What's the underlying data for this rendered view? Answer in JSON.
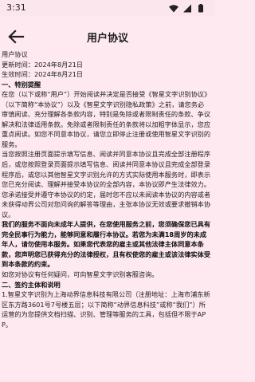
{
  "status_bar": {
    "time": "3:31"
  },
  "header": {
    "title": "用户协议"
  },
  "doc": {
    "heading": "用户协议",
    "updated": "更新时间：2024年8月21日",
    "effective": "生效时间：2024年8月21日",
    "section1_title": "一、特别提醒",
    "p1": "在您（以下或称“用户”）开始阅读并决定是否接受《智星文字识别协议》（以下简称“本协议”）以及《智星文字识别隐私政策》之前，请您务必审慎阅读、充分理解各条款内容，特别是免除或者限制责任的条款、争议解决和法律适用条款。免除或者限制责任的条款将以加粗字体显示，您应重点阅读。如您不同意本协议，请您立即停止注册或使用智星文字识别的服务。",
    "p2": "当您按照注册页面提示填写信息、阅读并同意本协议且完成全部注册程序后，或您按照登录页面提示填写信息、阅读并同意本协议且完成全部登录程序后，或您以其他智星文字识别允许的方式实际使用本服务时，即表示您已充分阅读、理解并接受本协议的全部内容，本协议即产生法律效力。您承诺接受并遵守本协议的约定，届时您不应以未阅读本协议的内容或者未获得动界公司对您问询的解答等理由，主张本协议无效或要求撤销本协议。",
    "p3_bold": "我们的服务不面向未成年人提供，在您使用服务之前，您须确保您已具有完全民事行为能力，能够同意和履行本协议。若您为未满18周岁的未成年人，请勿使用本服务。如果您代表您的雇主或其他法律主体同意本条款，您声明您已获得充分的法律授权，且有权使您的雇主或该法律实体受到本条款的约束。",
    "p4": "如您对协议有任何疑问，可向智星文字识别客服咨询。",
    "section2_title": "二、签约主体和说明",
    "p5": "1.智星文字识别为上海动界信息科技有限公司（注册地址：上海市浦东新区东方路3601号7号楼五层；以下简称“动界信息科技”或称“我们”）所运营的为您提供文档扫描、识别、管理等服务的工具，包括但不限于APP。"
  }
}
